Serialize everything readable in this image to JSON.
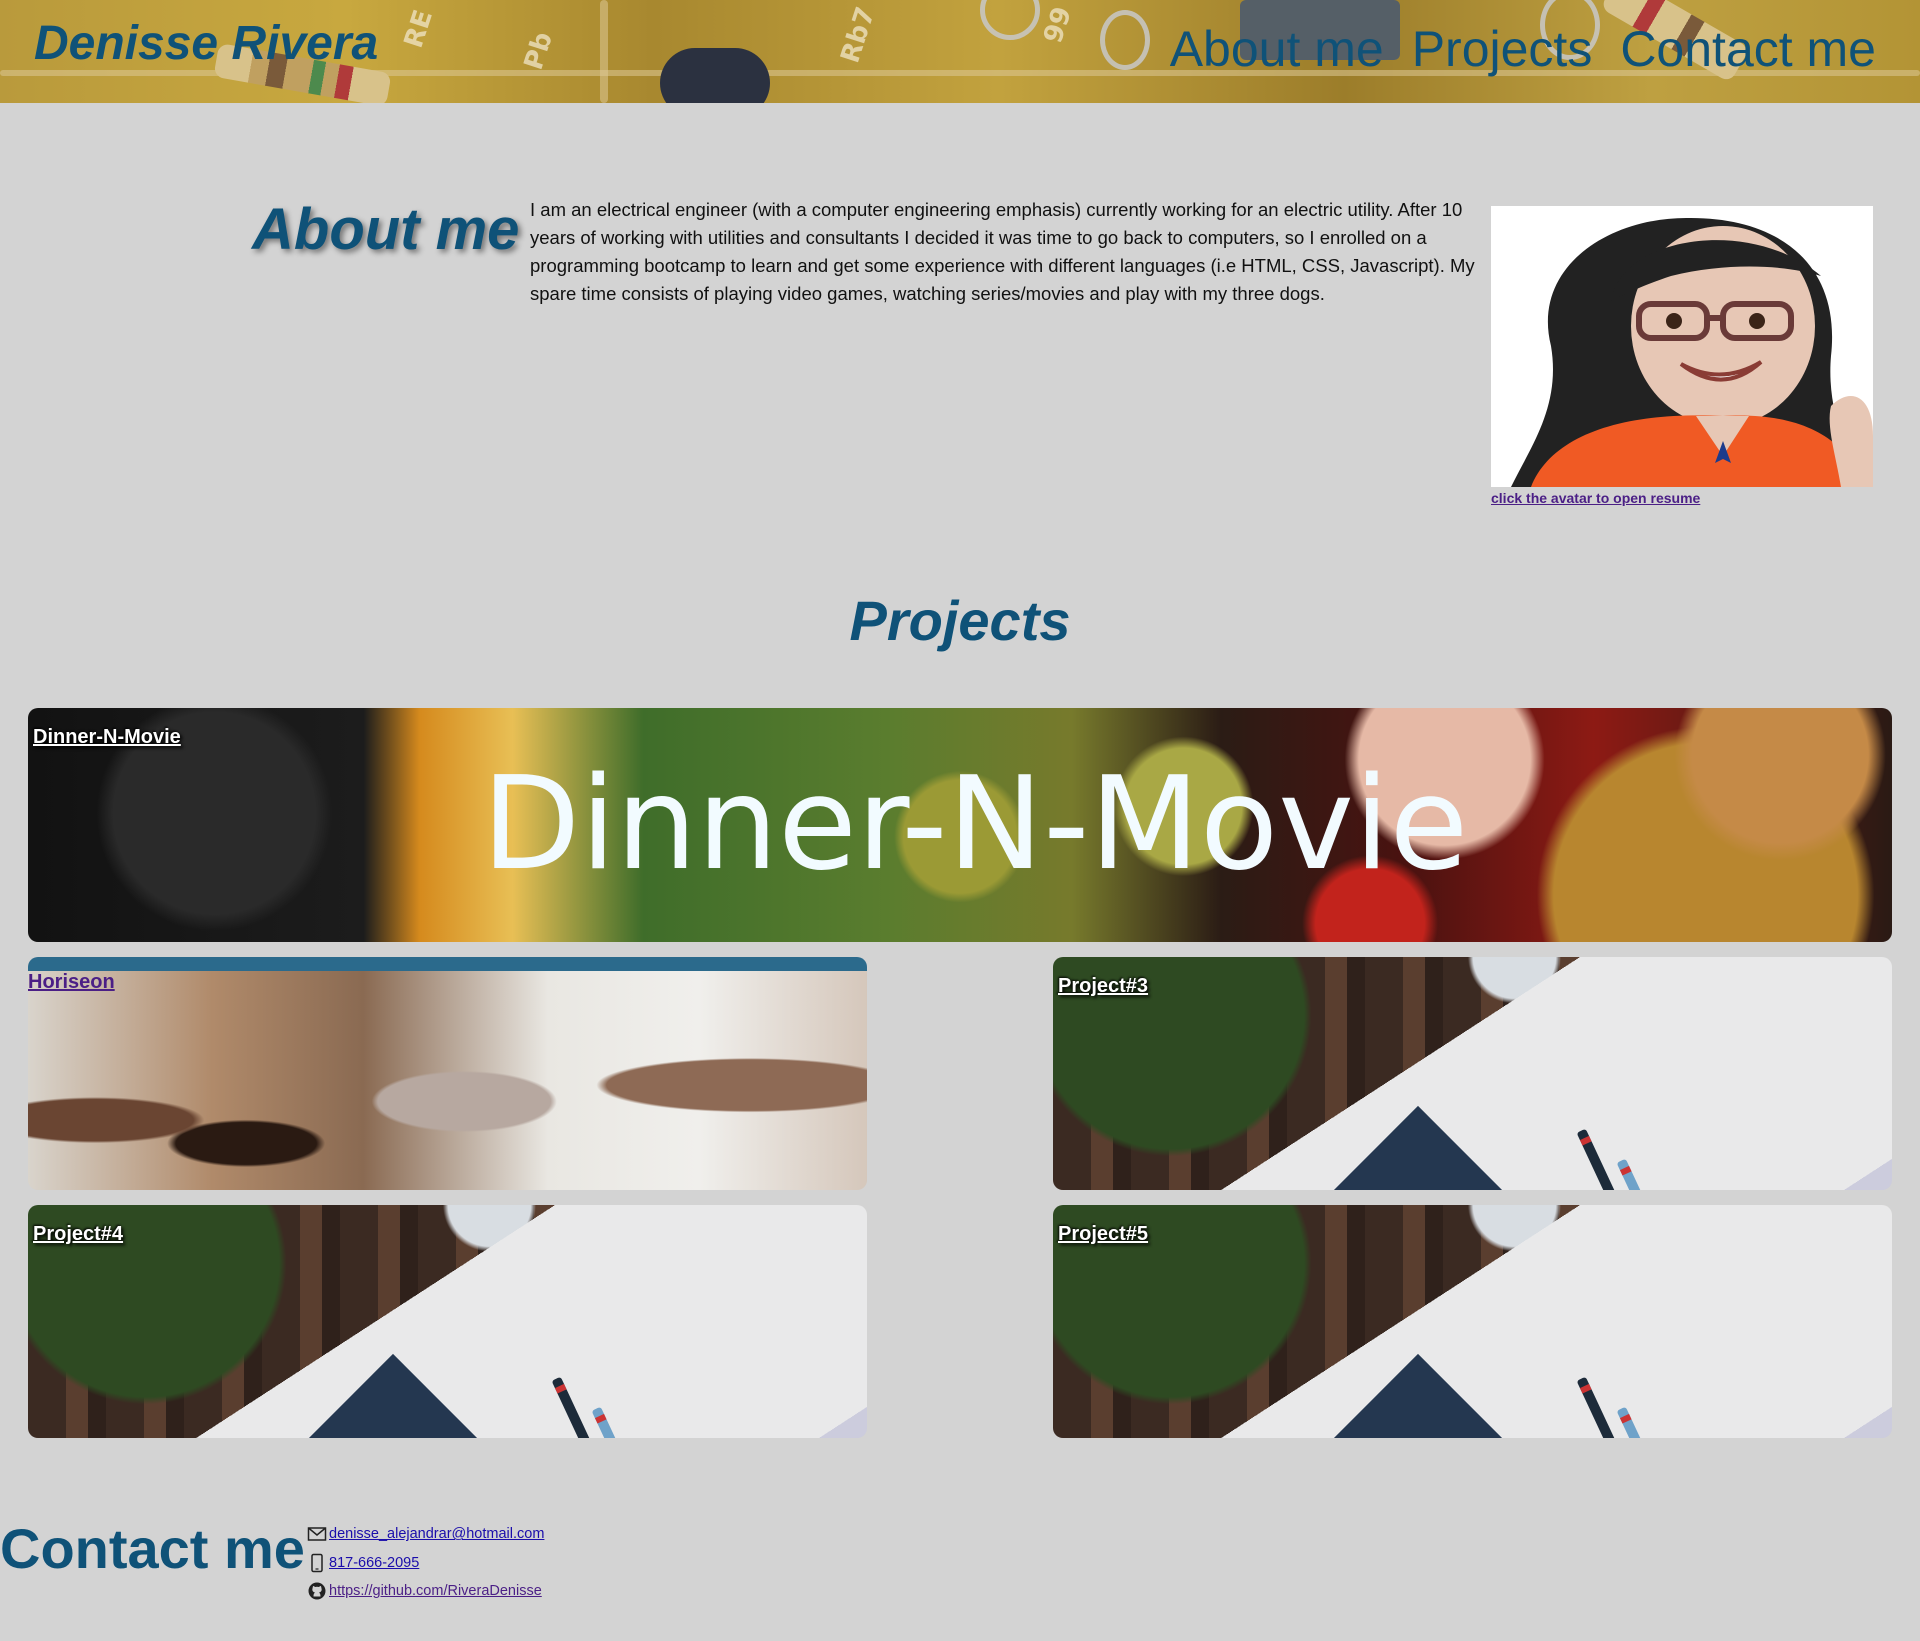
{
  "header": {
    "site_title": "Denisse Rivera",
    "nav": [
      {
        "label": "About me"
      },
      {
        "label": "Projects"
      },
      {
        "label": "Contact me"
      }
    ]
  },
  "about": {
    "title": "About me",
    "text": "I am an electrical engineer (with a computer engineering emphasis) currently working for an electric utility. After 10 years of working with utilities and consultants I decided it was time to go back to computers, so I enrolled on a programming bootcamp to learn and get some experience with different languages (i.e HTML, CSS, Javascript). My spare time consists of playing video games, watching series/movies and play with my three dogs.",
    "avatar_caption": "click the avatar to open resume"
  },
  "projects": {
    "title": "Projects",
    "items": [
      {
        "label": "Dinner-N-Movie",
        "banner_text": "Dinner-N-Movie"
      },
      {
        "label": "Horiseon"
      },
      {
        "label": "Project#3"
      },
      {
        "label": "Project#4"
      },
      {
        "label": "Project#5"
      }
    ]
  },
  "contact": {
    "title": "Contact me",
    "email": "denisse_alejandrar@hotmail.com",
    "phone": "817-666-2095",
    "github": "https://github.com/RiveraDenisse"
  },
  "colors": {
    "accent": "#0f5278",
    "background": "#d3d3d3",
    "visited_link": "#4b1f86",
    "link": "#1a0dab"
  },
  "icons": [
    "envelope-icon",
    "phone-icon",
    "github-icon"
  ]
}
